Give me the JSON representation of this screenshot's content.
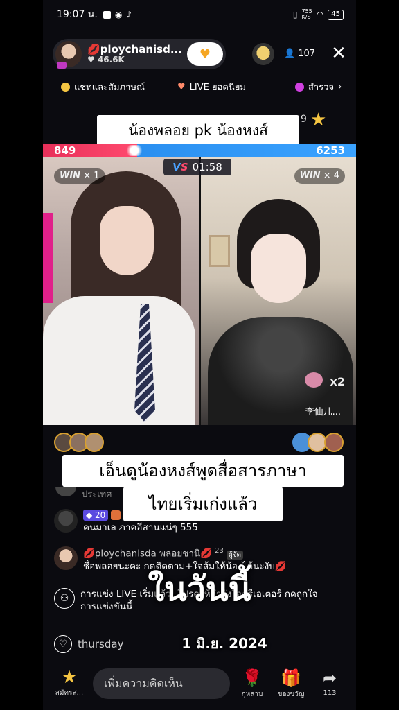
{
  "status": {
    "time": "19:07 น.",
    "net_speed": "755\nK/S",
    "battery": "45"
  },
  "host": {
    "name": "ploychanisd...",
    "likes": "46.6K"
  },
  "viewers": {
    "count": "107"
  },
  "tabs": [
    {
      "label": "แชทและสัมภาษณ์",
      "color": "#f5c542"
    },
    {
      "label": "LIVE ยอดนิยม",
      "color": "#ff8a6a"
    },
    {
      "label": "สำรวจ",
      "color": "#d040e0"
    }
  ],
  "pk": {
    "caption": "น้องพลอย pk น้องหงส์",
    "partial_count": "9",
    "score_left": "849",
    "score_right": "6253",
    "score_left_share": 0.12,
    "timer": "01:58",
    "win_left": "WIN",
    "win_left_count": "× 1",
    "win_right": "WIN",
    "win_right_count": "× 4",
    "multiplier": "x2",
    "guest_name": "李仙儿..."
  },
  "captions": {
    "line1": "เอ็นดูน้องหงส์พูดสื่อสารภาษา",
    "line2": "ไทยเริ่มเก่งแล้ว"
  },
  "comments": {
    "faded": "ประเทศ",
    "c1_level": "20",
    "c1_text": "คนมาเล ภาคอีสานแน่ๆ 555",
    "c2_user": "ploychanisda พลอยชานิ",
    "c2_count": "23",
    "c2_badge": "ผู้จัด",
    "c2_text": "ชื่อพลอยนะคะ กดติดตาม+ใจส้มให้น้องได้นะงับ",
    "c3_text": "การแข่ง LIVE เริ่มแล้ว! โปรดให้กำลังใจครีเอเตอร์ กดถูกใจการแข่งขันนี้",
    "c4_user": "thursday"
  },
  "overlay": {
    "big": "ในวันนี้",
    "date": "1 มิ.ย. 2024"
  },
  "bottom": {
    "subscribe_label": "สมัครส...",
    "comment_placeholder": "เพิ่มความคิดเห็น",
    "rose_label": "กุหลาบ",
    "gift_label": "ของขวัญ",
    "share_count": "113"
  }
}
